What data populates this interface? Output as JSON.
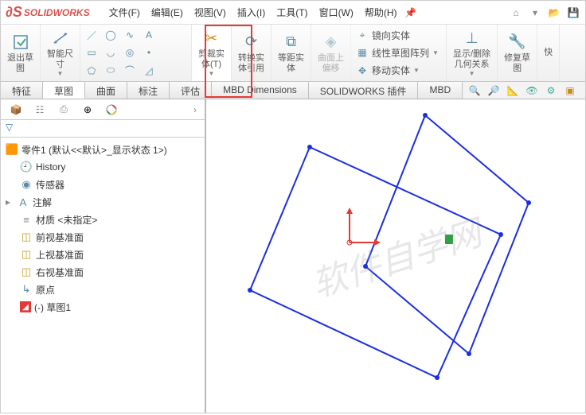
{
  "brand": "SOLIDWORKS",
  "menu": {
    "file": "文件(F)",
    "edit": "编辑(E)",
    "view": "视图(V)",
    "insert": "插入(I)",
    "tools": "工具(T)",
    "window": "窗口(W)",
    "help": "帮助(H)"
  },
  "ribbon": {
    "exit_sketch": "退出草\n图",
    "smart_dim": "智能尺\n寸",
    "trim": "剪裁实\n体(T)",
    "convert": "转换实\n体引用",
    "offset": "等距实\n体",
    "surface_curve": "曲面上\n偏移",
    "mirror": "镜向实体",
    "linear_pattern": "线性草图阵列",
    "move": "移动实体",
    "show_rel": "显示/删除\n几何关系",
    "repair": "修复草\n图",
    "quick": "快"
  },
  "tabs": {
    "feature": "特征",
    "sketch": "草图",
    "surface": "曲面",
    "annotate": "标注",
    "evaluate": "评估",
    "mbddim": "MBD Dimensions",
    "plugin": "SOLIDWORKS 插件",
    "mbd": "MBD"
  },
  "tree": {
    "root": "零件1  (默认<<默认>_显示状态 1>)",
    "history": "History",
    "sensors": "传感器",
    "annotations": "注解",
    "material": "材质 <未指定>",
    "front": "前视基准面",
    "top": "上视基准面",
    "right": "右视基准面",
    "origin": "原点",
    "sketch1": "(-) 草图1"
  },
  "watermark": "软件自学网"
}
